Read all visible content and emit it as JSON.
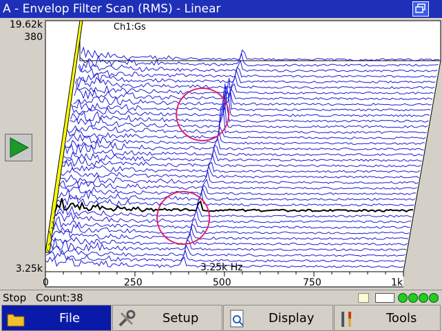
{
  "window": {
    "title": "A - Envelop Filter Scan (RMS) - Linear"
  },
  "plot": {
    "channel_label": "Ch1:Gs",
    "frequency_readout": "3.25k Hz",
    "y_labels": {
      "top": "19.62k",
      "top_secondary": "380",
      "bottom": "3.25k"
    },
    "x_ticks": [
      "0",
      "250",
      "500",
      "750",
      "1k"
    ],
    "colors": {
      "traces": "#1a1ad8",
      "current_trace": "#000000",
      "wall": "#ffff00",
      "marker_circle": "#e0206a",
      "background": "#ffffff"
    }
  },
  "chart_data": {
    "type": "line",
    "x_range": [
      0,
      1000
    ],
    "x_unit": "Hz",
    "series_count": 38,
    "highlighted_peak_hz": 385,
    "drifting_peak_hz": [
      385,
      452
    ]
  },
  "status": {
    "state": "Stop",
    "count": "Count:38"
  },
  "menu": {
    "file": "File",
    "setup": "Setup",
    "display": "Display",
    "tools": "Tools"
  }
}
